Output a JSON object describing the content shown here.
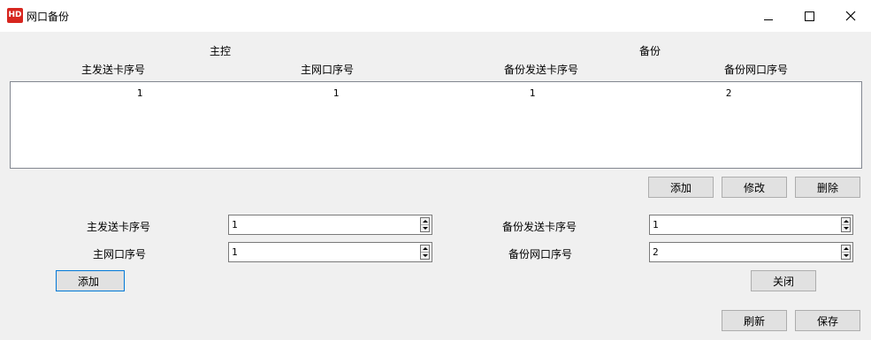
{
  "window": {
    "logo_text": "HD",
    "title": "网口备份"
  },
  "headers": {
    "main_group": "主控",
    "backup_group": "备份",
    "columns": [
      "主发送卡序号",
      "主网口序号",
      "备份发送卡序号",
      "备份网口序号"
    ]
  },
  "table": {
    "rows": [
      [
        "1",
        "1",
        "1",
        "2"
      ]
    ]
  },
  "row_buttons": {
    "add": "添加",
    "modify": "修改",
    "delete": "删除"
  },
  "form": {
    "main_card_label": "主发送卡序号",
    "main_card_value": "1",
    "main_port_label": "主网口序号",
    "main_port_value": "1",
    "backup_card_label": "备份发送卡序号",
    "backup_card_value": "1",
    "backup_port_label": "备份网口序号",
    "backup_port_value": "2",
    "add": "添加"
  },
  "footer": {
    "close": "关闭",
    "refresh": "刷新",
    "save": "保存"
  },
  "colors": {
    "accent": "#0078d7",
    "logo": "#d7261f"
  }
}
